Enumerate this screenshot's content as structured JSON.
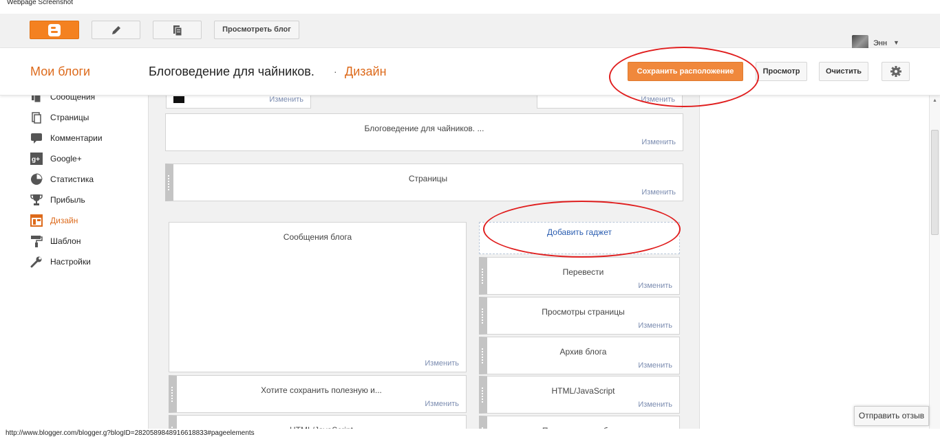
{
  "caption": "Webpage Screenshot",
  "topbar": {
    "view_blog_label": "Просмотреть блог",
    "username": "Энн",
    "icons": [
      "blogger-icon",
      "pencil-icon",
      "posts-icon",
      "chevron-down-icon"
    ]
  },
  "header": {
    "my_blogs": "Мои блоги",
    "blog_title": "Блоговедение для чайников.",
    "separator": "·",
    "section": "Дизайн",
    "save_label": "Сохранить расположение",
    "preview_label": "Просмотр",
    "clear_label": "Очистить"
  },
  "sidebar": {
    "items": [
      {
        "label": "Сообщения",
        "icon": "posts-icon"
      },
      {
        "label": "Страницы",
        "icon": "pages-icon"
      },
      {
        "label": "Комментарии",
        "icon": "comment-icon"
      },
      {
        "label": "Google+",
        "icon": "google-plus-icon"
      },
      {
        "label": "Статистика",
        "icon": "pie-chart-icon"
      },
      {
        "label": "Прибыль",
        "icon": "trophy-icon"
      },
      {
        "label": "Дизайн",
        "icon": "layout-icon",
        "active": true
      },
      {
        "label": "Шаблон",
        "icon": "paint-roller-icon"
      },
      {
        "label": "Настройки",
        "icon": "wrench-icon"
      }
    ]
  },
  "layout": {
    "edit_label": "Изменить",
    "header_widget": "Блоговедение для чайников. ...",
    "pages_widget": "Страницы",
    "main_widget": "Сообщения блога",
    "main_bottom": [
      "Хотите сохранить полезную и...",
      "HTML/JavaScript"
    ],
    "add_gadget": "Добавить гаджет",
    "right_widgets": [
      "Перевести",
      "Просмотры страницы",
      "Архив блога",
      "HTML/JavaScript",
      "Поиск по этому блогу"
    ]
  },
  "colors": {
    "accent": "#dd6a1b",
    "save_button": "#f0883c",
    "link": "#2a5db0",
    "annotation": "#e01e1e"
  },
  "feedback_label": "Отправить отзыв",
  "status_url": "http://www.blogger.com/blogger.g?blogID=2820589848916618833#pageelements"
}
